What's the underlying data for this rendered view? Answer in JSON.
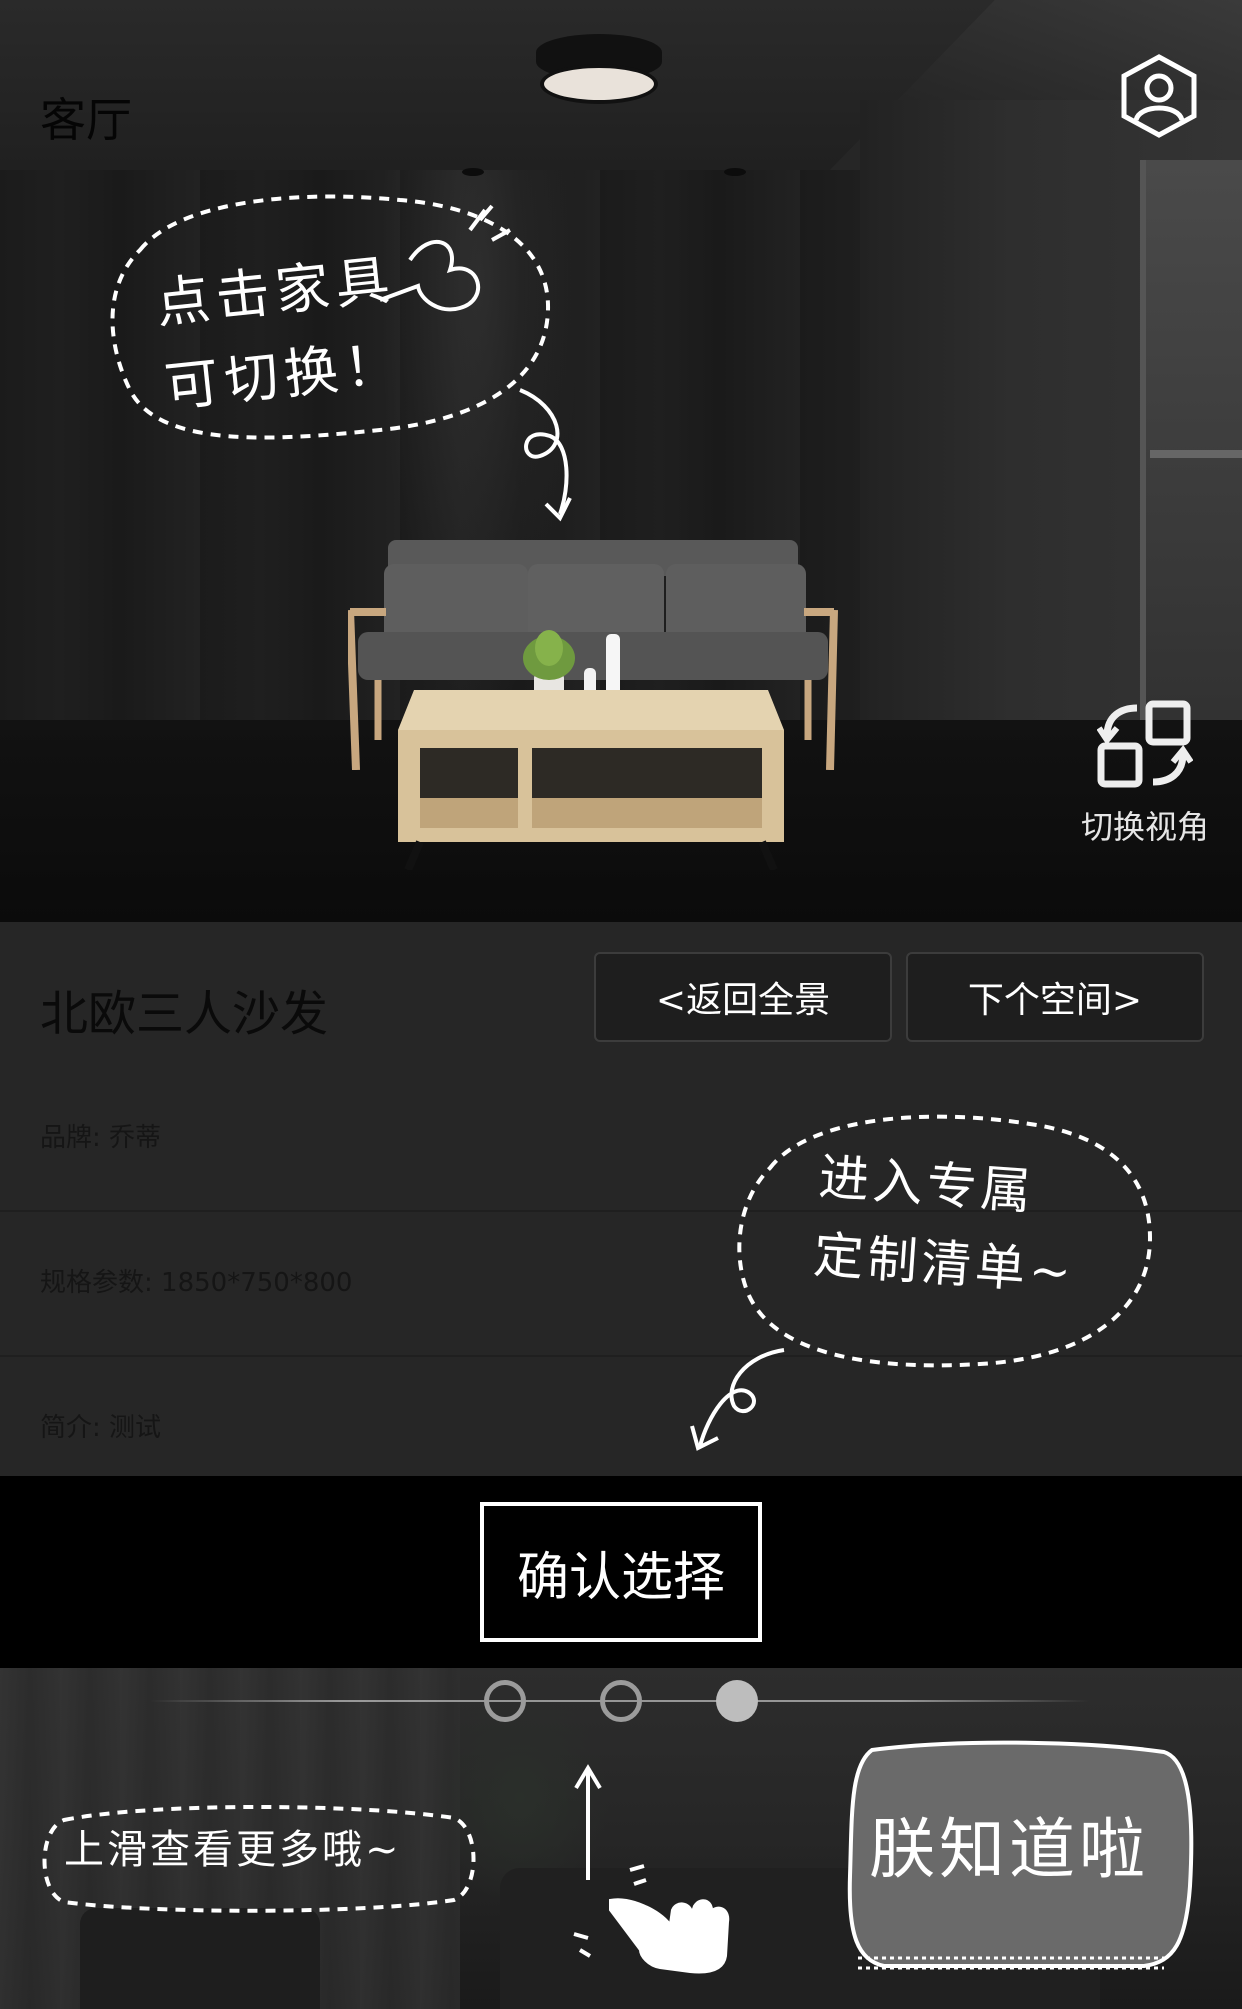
{
  "header": {
    "room_title": "客厅",
    "profile_icon": "user-profile-hexagon-icon"
  },
  "scene": {
    "switch_view_label": "切换视角",
    "switch_view_icon": "rotate-view-icon",
    "hint_bubble": [
      "点击家具",
      "可切换！"
    ]
  },
  "product": {
    "name": "北欧三人沙发",
    "back_label": "<返回全景",
    "next_label": "下个空间>",
    "details": [
      "品牌: 乔蒂",
      "规格参数: 1850*750*800",
      "简介: 测试"
    ],
    "hint_bubble": [
      "进入专属",
      "定制清单~"
    ]
  },
  "confirm": {
    "label": "确认选择"
  },
  "pager": {
    "total": 3,
    "current": 3
  },
  "bottom": {
    "swipe_hint": "上滑查看更多哦~",
    "got_it_label": "朕知道啦",
    "swipe_icon": "swipe-up-hand-icon"
  },
  "colors": {
    "background": "#262626",
    "confirm_bar": "#000000",
    "accent_white": "#ffffff"
  }
}
